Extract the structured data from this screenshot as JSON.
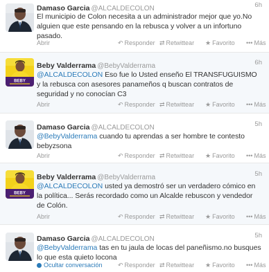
{
  "actions": {
    "open": "Abrir",
    "reply": "Responder",
    "retweet": "Retwittear",
    "favorite": "Favorito",
    "more": "Más",
    "hide_conversation": "Ocultar conversación"
  },
  "icons": {
    "reply": "reply-arrow-icon",
    "retweet": "retweet-icon",
    "favorite": "star-icon",
    "more": "more-dots-icon"
  },
  "colors": {
    "link": "#2b7bb9",
    "highlight_bg": "#f5f8fb",
    "meta_gray": "#999999"
  },
  "tweets": [
    {
      "fullname": "Damaso Garcia",
      "username": "@ALCALDECOLON",
      "time": "6h",
      "mention": "",
      "text": "El municipio de Colon necesita a un administrador mejor que yo.No alguien que este pensando en la rebusca y volver a un infortuno pasado."
    },
    {
      "fullname": "Beby Valderrama",
      "username": "@BebyValderrama",
      "time": "6h",
      "mention": "@ALCALDECOLON",
      "text": " Eso fue lo Usted enseño El TRANSFUGUISMO y la rebusca con asesores panameños q buscan contratos de seguridad y no conocían C3",
      "badge": "BEBY"
    },
    {
      "fullname": "Damaso Garcia",
      "username": "@ALCALDECOLON",
      "time": "5h",
      "mention": "@BebyValderrama",
      "text": "  cuando tu aprendas a ser hombre te contesto bebyzsona"
    },
    {
      "fullname": "Beby Valderrama",
      "username": "@BebyValderrama",
      "time": "5h",
      "mention": "@ALCALDECOLON",
      "text": " usted ya demostró ser un verdadero cómico en la política... Serás recordado como un Alcalde rebuscon y vendedor de Colón.",
      "badge": "BEBY"
    },
    {
      "fullname": "Damaso Garcia",
      "username": "@ALCALDECOLON",
      "time": "5h",
      "mention": "@BebyValderrama",
      "text": " tas en tu jaula de locas del paneñismo.no busques lo que esta quieto locona"
    }
  ]
}
